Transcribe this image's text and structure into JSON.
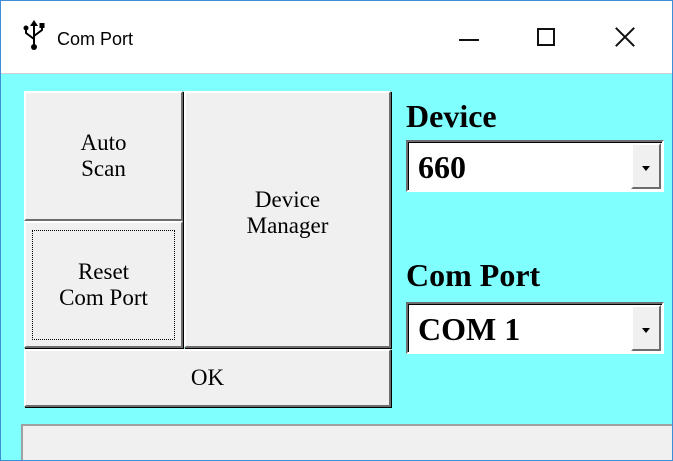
{
  "window": {
    "title": "Com Port",
    "icon": "usb-icon",
    "controls": {
      "minimize": "minimize-icon",
      "maximize": "maximize-icon",
      "close": "close-icon"
    }
  },
  "buttons": {
    "auto_scan": "Auto\nScan",
    "reset_com_port": "Reset\nCom Port",
    "device_manager": "Device\nManager",
    "ok": "OK"
  },
  "device": {
    "label": "Device",
    "selected": "660"
  },
  "com_port": {
    "label": "Com Port",
    "selected": "COM  1"
  },
  "colors": {
    "client_background": "#80ffff",
    "button_face": "#f0f0f0"
  }
}
